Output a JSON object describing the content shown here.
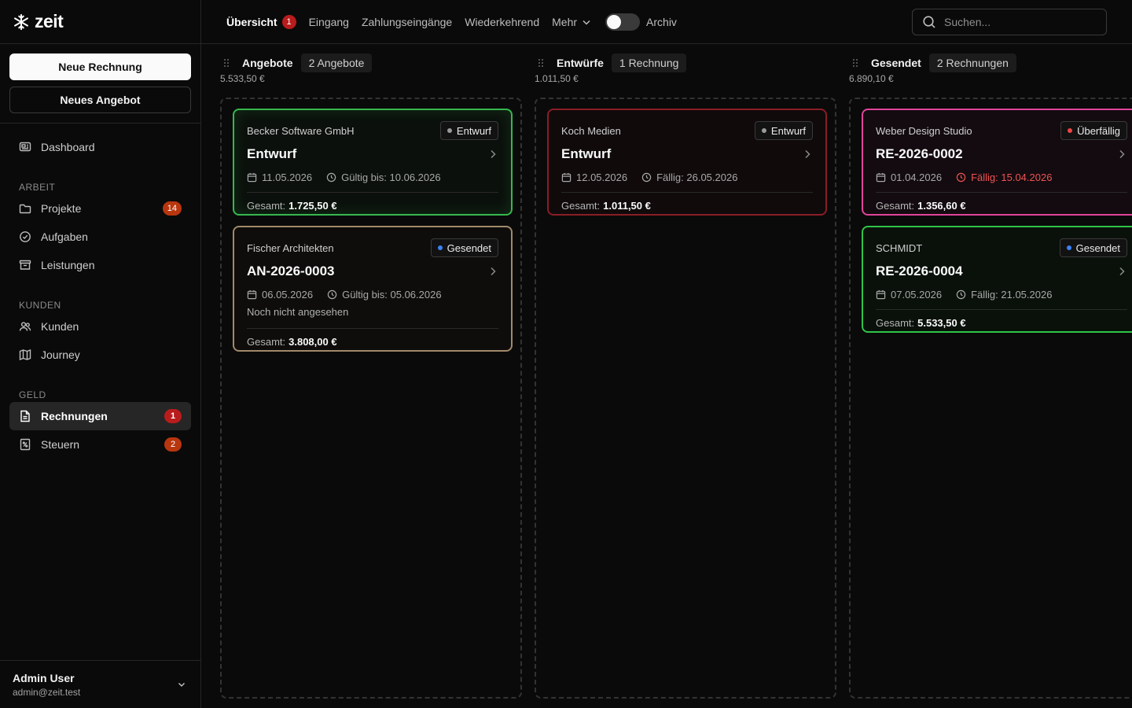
{
  "app": {
    "name": "zeit"
  },
  "sidebar": {
    "new_invoice": "Neue Rechnung",
    "new_offer": "Neues Angebot",
    "dashboard": "Dashboard",
    "sections": {
      "work": "ARBEIT",
      "customers": "KUNDEN",
      "money": "GELD"
    },
    "items": {
      "projekte": {
        "label": "Projekte",
        "badge": "14"
      },
      "aufgaben": {
        "label": "Aufgaben"
      },
      "leistungen": {
        "label": "Leistungen"
      },
      "kunden": {
        "label": "Kunden"
      },
      "journey": {
        "label": "Journey"
      },
      "rechnungen": {
        "label": "Rechnungen",
        "badge": "1"
      },
      "steuern": {
        "label": "Steuern",
        "badge": "2"
      }
    },
    "user": {
      "name": "Admin User",
      "email": "admin@zeit.test"
    }
  },
  "topbar": {
    "tabs": [
      {
        "label": "Übersicht",
        "badge": "1"
      },
      {
        "label": "Eingang"
      },
      {
        "label": "Zahlungseingänge"
      },
      {
        "label": "Wiederkehrend"
      },
      {
        "label": "Mehr"
      }
    ],
    "archive_label": "Archiv",
    "archive_on": false,
    "search_placeholder": "Suchen..."
  },
  "columns": [
    {
      "title": "Angebote",
      "count": "2 Angebote",
      "sum": "5.533,50 €",
      "cards": [
        {
          "client": "Becker Software GmbH",
          "status": "Entwurf",
          "title": "Entwurf",
          "date": "11.05.2026",
          "due": "Gültig bis: 10.06.2026",
          "total_label": "Gesamt:",
          "total": "1.725,50 €"
        },
        {
          "client": "Fischer Architekten",
          "status": "Gesendet",
          "title": "AN-2026-0003",
          "date": "06.05.2026",
          "due": "Gültig bis: 05.06.2026",
          "note": "Noch nicht angesehen",
          "total_label": "Gesamt:",
          "total": "3.808,00 €"
        }
      ]
    },
    {
      "title": "Entwürfe",
      "count": "1 Rechnung",
      "sum": "1.011,50 €",
      "cards": [
        {
          "client": "Koch Medien",
          "status": "Entwurf",
          "title": "Entwurf",
          "date": "12.05.2026",
          "due": "Fällig: 26.05.2026",
          "total_label": "Gesamt:",
          "total": "1.011,50 €"
        }
      ]
    },
    {
      "title": "Gesendet",
      "count": "2 Rechnungen",
      "sum": "6.890,10 €",
      "cards": [
        {
          "client": "Weber Design Studio",
          "status": "Überfällig",
          "title": "RE-2026-0002",
          "date": "01.04.2026",
          "due": "Fällig: 15.04.2026",
          "total_label": "Gesamt:",
          "total": "1.356,60 €"
        },
        {
          "client": "SCHMIDT",
          "status": "Gesendet",
          "title": "RE-2026-0004",
          "date": "07.05.2026",
          "due": "Fällig: 21.05.2026",
          "total_label": "Gesamt:",
          "total": "5.533,50 €"
        }
      ]
    }
  ],
  "colors": {
    "status_draft": "#9a9a9a",
    "status_sent": "#3b82f6",
    "status_overdue": "#ef4444",
    "badge_orange": "#b8360e",
    "badge_red": "#b91c1c"
  }
}
